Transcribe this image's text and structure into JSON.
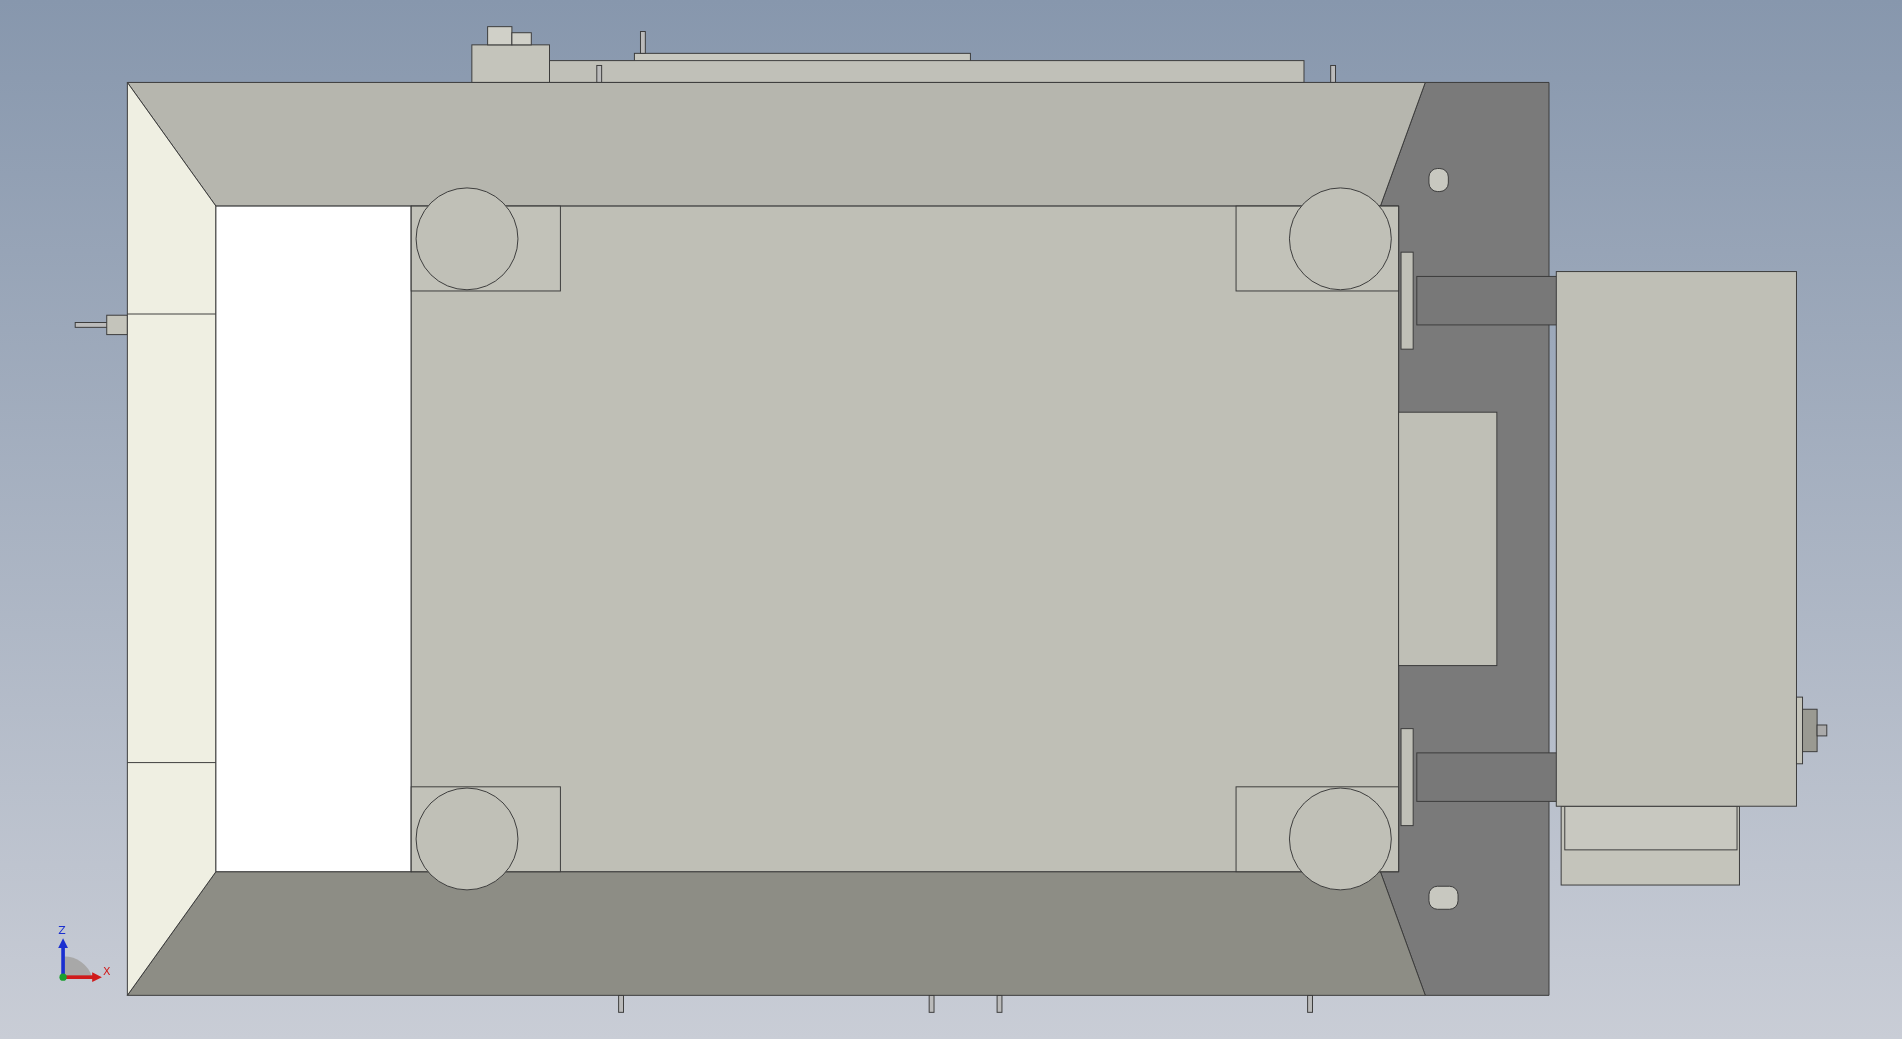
{
  "triad": {
    "z_label": "Z",
    "x_label": "X"
  }
}
